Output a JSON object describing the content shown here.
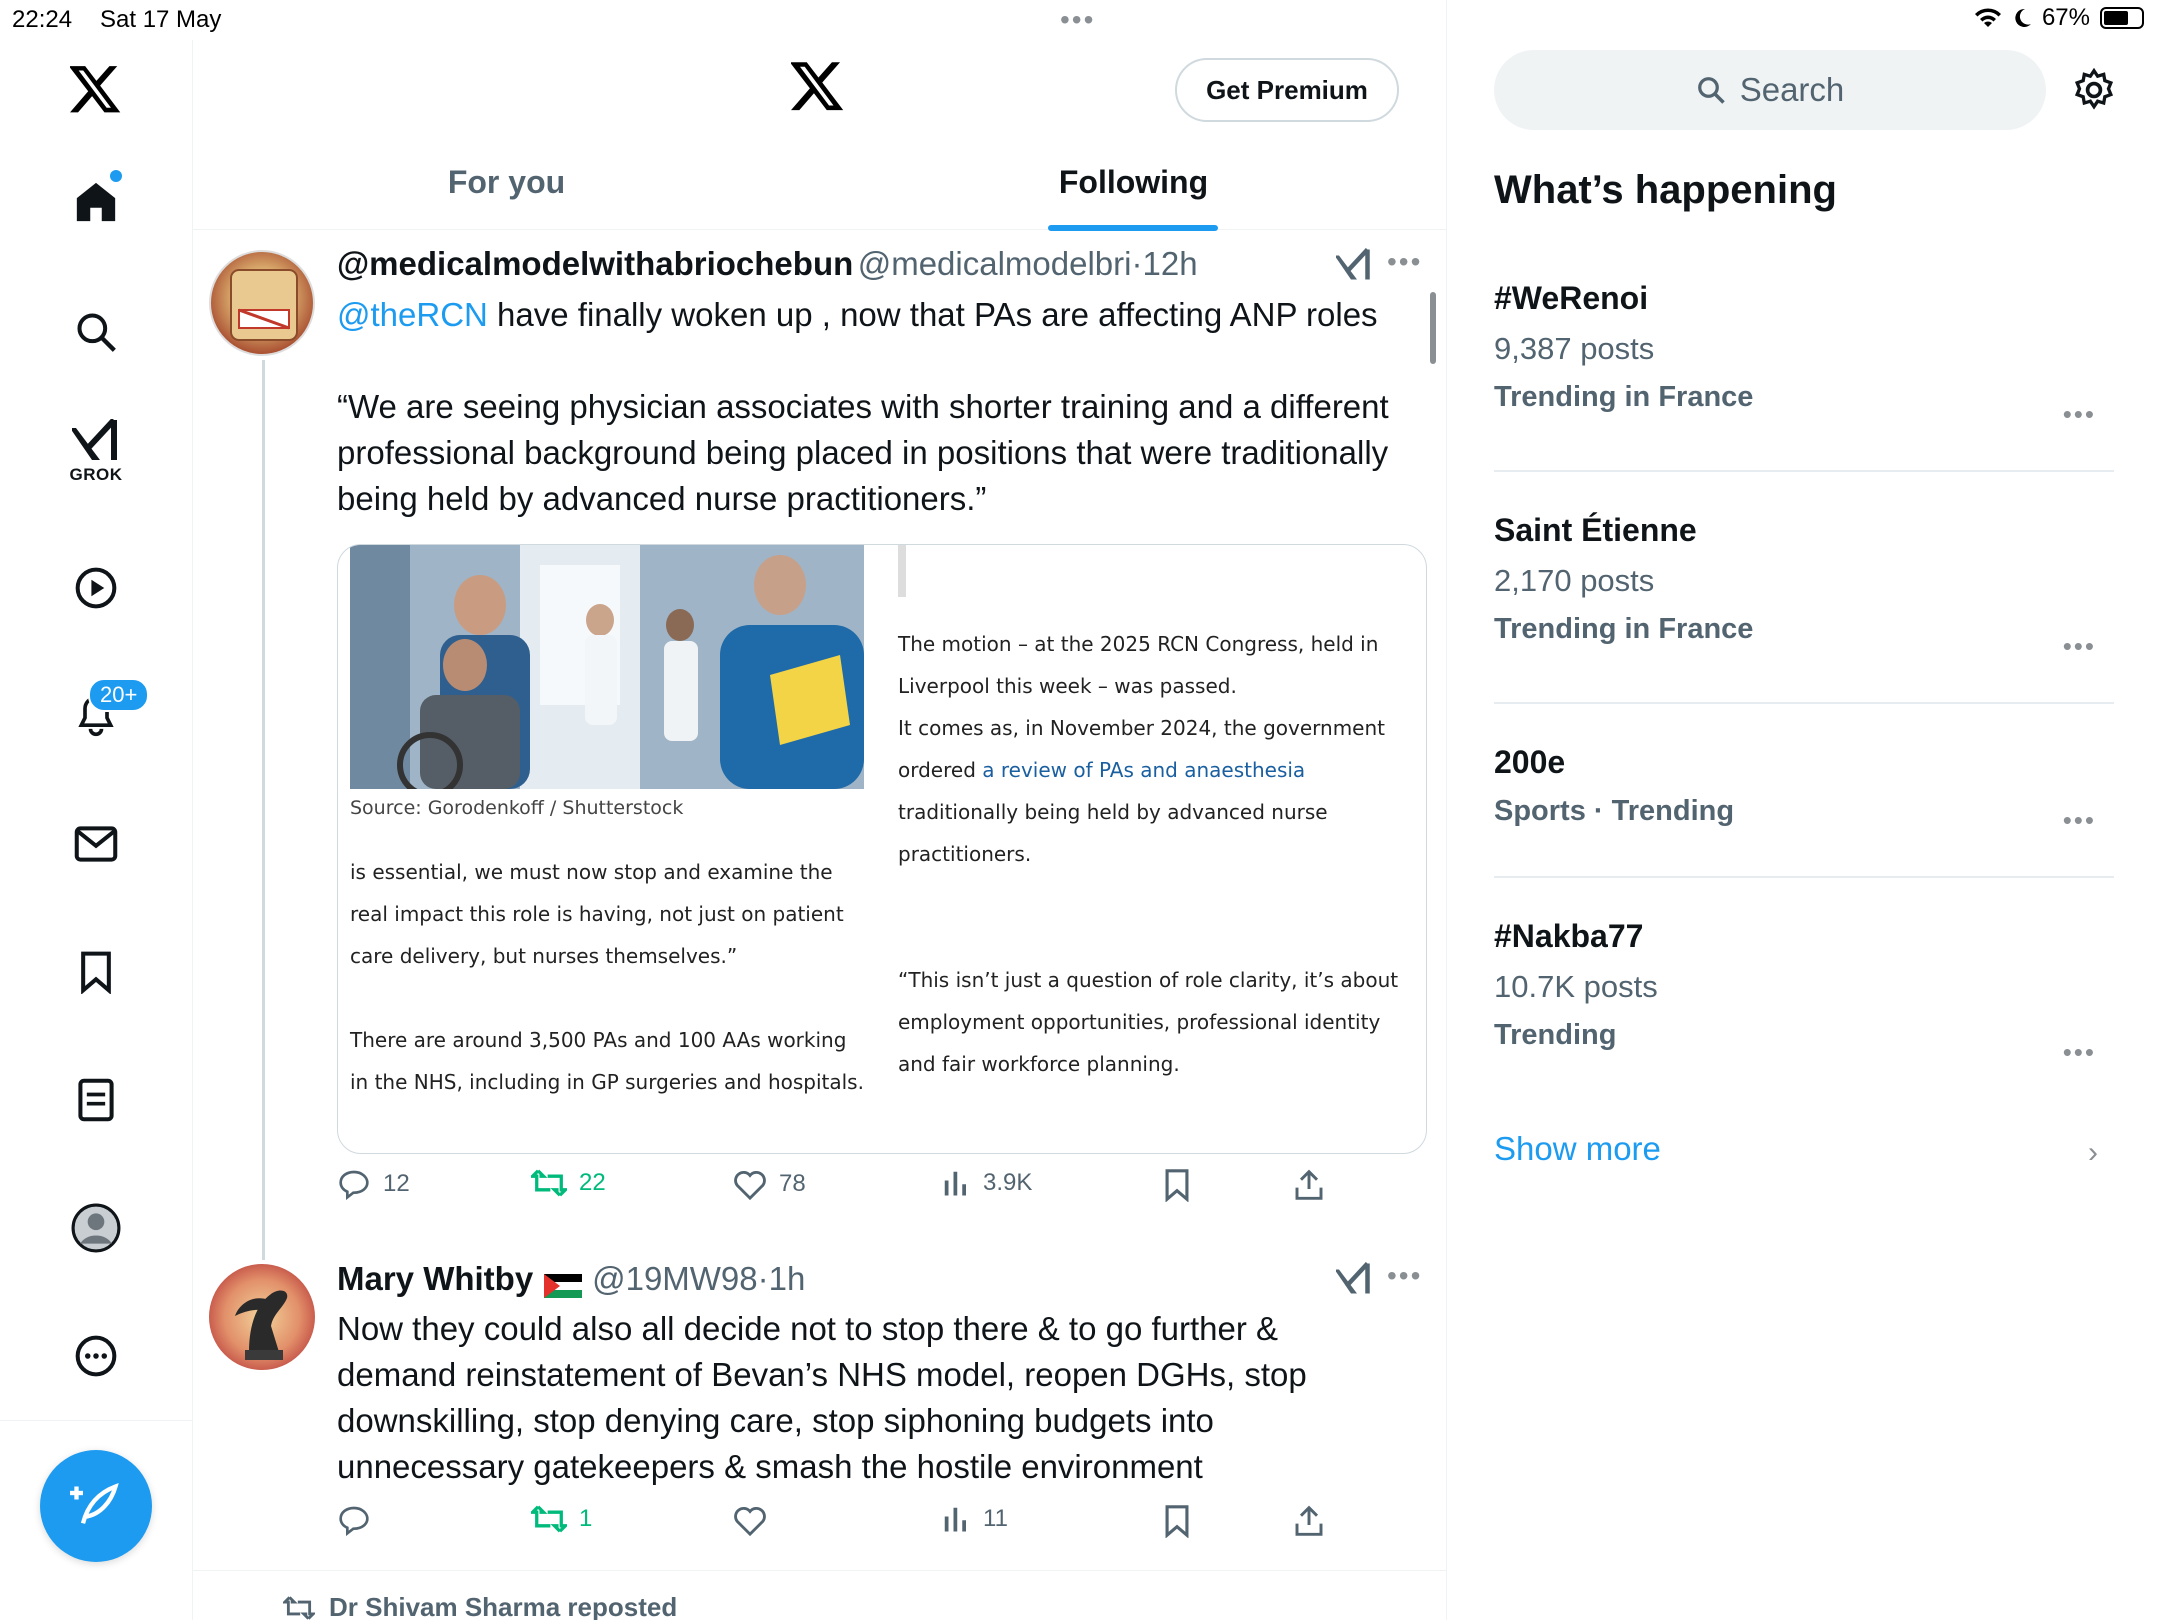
{
  "status": {
    "time": "22:24",
    "date": "Sat 17 May",
    "battery_percent": "67%",
    "battery_level": 0.67
  },
  "rail": {
    "grok_label": "GROK",
    "notifications_badge": "20+"
  },
  "header": {
    "premium_label": "Get Premium"
  },
  "tabs": [
    {
      "label": "For you"
    },
    {
      "label": "Following"
    }
  ],
  "tweet1": {
    "display_name": "@medicalmodelwithabriochebun",
    "handle": "@medicalmodelbri",
    "time": "12h",
    "mention": "@theRCN",
    "text_line1": " have finally woken up , now that PAs are affecting ANP roles",
    "quote": "“We are seeing physician associates with shorter training and a different professional background being placed in positions that were traditionally being held by advanced nurse practitioners.”",
    "card": {
      "caption": "Source:  Gorodenkoff / Shutterstock",
      "left_para1": "is essential, we must now stop and examine the real impact this role is having, not just on patient care delivery, but nurses themselves.”",
      "left_para2": "There are around 3,500 PAs and 100 AAs working in the NHS, including in GP surgeries and hospitals.",
      "right_para1": "The motion – at the 2025 RCN Congress, held in Liverpool this week – was passed.",
      "right_para2_a": "It comes as, in November 2024, the government ordered ",
      "right_para2_link": "a review of PAs and anaesthesia associates",
      "right_para3": "traditionally being held by advanced nurse practitioners.",
      "right_para4": "“This isn’t just a question of role clarity, it’s about employment opportunities, professional identity and fair workforce planning."
    },
    "stats": {
      "replies": "12",
      "reposts": "22",
      "likes": "78",
      "views": "3.9K"
    }
  },
  "tweet2": {
    "display_name": "Mary Whitby",
    "handle": "@19MW98",
    "time": "1h",
    "text": "Now they could also all decide not to stop there & to go further & demand reinstatement of Bevan’s NHS model, reopen DGHs, stop downskilling, stop denying care, stop siphoning budgets into unnecessary gatekeepers & smash the hostile environment",
    "stats": {
      "replies": "",
      "reposts": "1",
      "likes": "",
      "views": "11"
    }
  },
  "next_repost": "Dr Shivam Sharma reposted",
  "sidebar": {
    "search_placeholder": "Search",
    "title": "What’s happening",
    "trends": [
      {
        "name": "#WeRenoi",
        "count": "9,387 posts",
        "context": "Trending in France"
      },
      {
        "name": "Saint Étienne",
        "count": "2,170 posts",
        "context": "Trending in France"
      },
      {
        "name": "200e",
        "count": "",
        "context": "Sports · Trending"
      },
      {
        "name": "#Nakba77",
        "count": "10.7K posts",
        "context": "Trending"
      }
    ],
    "show_more": "Show more"
  },
  "icons": [
    "x-logo-icon",
    "home-icon",
    "search-icon",
    "grok-icon",
    "video-icon",
    "bell-icon",
    "mail-icon",
    "bookmark-icon",
    "lists-icon",
    "profile-icon",
    "more-icon",
    "compose-icon",
    "gear-icon",
    "reply-icon",
    "repost-icon",
    "like-icon",
    "views-icon",
    "share-icon"
  ],
  "colors": {
    "accent": "#1d9bf0",
    "repost": "#00ba7c",
    "muted": "#536471"
  }
}
